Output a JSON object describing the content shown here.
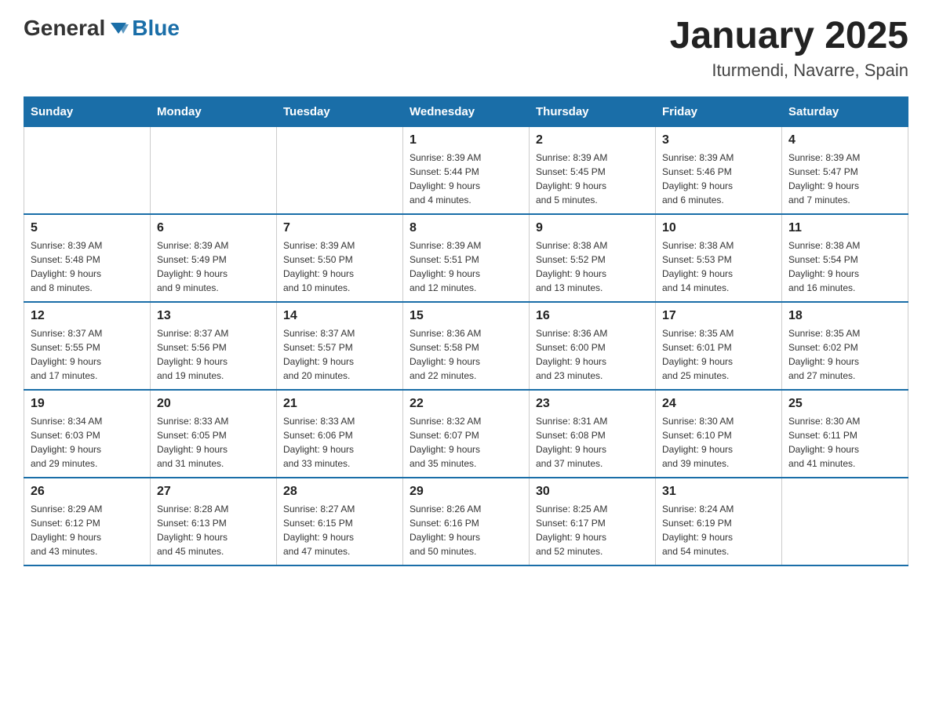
{
  "logo": {
    "text_general": "General",
    "text_blue": "Blue"
  },
  "title": {
    "month_year": "January 2025",
    "location": "Iturmendi, Navarre, Spain"
  },
  "weekdays": [
    "Sunday",
    "Monday",
    "Tuesday",
    "Wednesday",
    "Thursday",
    "Friday",
    "Saturday"
  ],
  "weeks": [
    [
      {
        "day": "",
        "info": ""
      },
      {
        "day": "",
        "info": ""
      },
      {
        "day": "",
        "info": ""
      },
      {
        "day": "1",
        "info": "Sunrise: 8:39 AM\nSunset: 5:44 PM\nDaylight: 9 hours\nand 4 minutes."
      },
      {
        "day": "2",
        "info": "Sunrise: 8:39 AM\nSunset: 5:45 PM\nDaylight: 9 hours\nand 5 minutes."
      },
      {
        "day": "3",
        "info": "Sunrise: 8:39 AM\nSunset: 5:46 PM\nDaylight: 9 hours\nand 6 minutes."
      },
      {
        "day": "4",
        "info": "Sunrise: 8:39 AM\nSunset: 5:47 PM\nDaylight: 9 hours\nand 7 minutes."
      }
    ],
    [
      {
        "day": "5",
        "info": "Sunrise: 8:39 AM\nSunset: 5:48 PM\nDaylight: 9 hours\nand 8 minutes."
      },
      {
        "day": "6",
        "info": "Sunrise: 8:39 AM\nSunset: 5:49 PM\nDaylight: 9 hours\nand 9 minutes."
      },
      {
        "day": "7",
        "info": "Sunrise: 8:39 AM\nSunset: 5:50 PM\nDaylight: 9 hours\nand 10 minutes."
      },
      {
        "day": "8",
        "info": "Sunrise: 8:39 AM\nSunset: 5:51 PM\nDaylight: 9 hours\nand 12 minutes."
      },
      {
        "day": "9",
        "info": "Sunrise: 8:38 AM\nSunset: 5:52 PM\nDaylight: 9 hours\nand 13 minutes."
      },
      {
        "day": "10",
        "info": "Sunrise: 8:38 AM\nSunset: 5:53 PM\nDaylight: 9 hours\nand 14 minutes."
      },
      {
        "day": "11",
        "info": "Sunrise: 8:38 AM\nSunset: 5:54 PM\nDaylight: 9 hours\nand 16 minutes."
      }
    ],
    [
      {
        "day": "12",
        "info": "Sunrise: 8:37 AM\nSunset: 5:55 PM\nDaylight: 9 hours\nand 17 minutes."
      },
      {
        "day": "13",
        "info": "Sunrise: 8:37 AM\nSunset: 5:56 PM\nDaylight: 9 hours\nand 19 minutes."
      },
      {
        "day": "14",
        "info": "Sunrise: 8:37 AM\nSunset: 5:57 PM\nDaylight: 9 hours\nand 20 minutes."
      },
      {
        "day": "15",
        "info": "Sunrise: 8:36 AM\nSunset: 5:58 PM\nDaylight: 9 hours\nand 22 minutes."
      },
      {
        "day": "16",
        "info": "Sunrise: 8:36 AM\nSunset: 6:00 PM\nDaylight: 9 hours\nand 23 minutes."
      },
      {
        "day": "17",
        "info": "Sunrise: 8:35 AM\nSunset: 6:01 PM\nDaylight: 9 hours\nand 25 minutes."
      },
      {
        "day": "18",
        "info": "Sunrise: 8:35 AM\nSunset: 6:02 PM\nDaylight: 9 hours\nand 27 minutes."
      }
    ],
    [
      {
        "day": "19",
        "info": "Sunrise: 8:34 AM\nSunset: 6:03 PM\nDaylight: 9 hours\nand 29 minutes."
      },
      {
        "day": "20",
        "info": "Sunrise: 8:33 AM\nSunset: 6:05 PM\nDaylight: 9 hours\nand 31 minutes."
      },
      {
        "day": "21",
        "info": "Sunrise: 8:33 AM\nSunset: 6:06 PM\nDaylight: 9 hours\nand 33 minutes."
      },
      {
        "day": "22",
        "info": "Sunrise: 8:32 AM\nSunset: 6:07 PM\nDaylight: 9 hours\nand 35 minutes."
      },
      {
        "day": "23",
        "info": "Sunrise: 8:31 AM\nSunset: 6:08 PM\nDaylight: 9 hours\nand 37 minutes."
      },
      {
        "day": "24",
        "info": "Sunrise: 8:30 AM\nSunset: 6:10 PM\nDaylight: 9 hours\nand 39 minutes."
      },
      {
        "day": "25",
        "info": "Sunrise: 8:30 AM\nSunset: 6:11 PM\nDaylight: 9 hours\nand 41 minutes."
      }
    ],
    [
      {
        "day": "26",
        "info": "Sunrise: 8:29 AM\nSunset: 6:12 PM\nDaylight: 9 hours\nand 43 minutes."
      },
      {
        "day": "27",
        "info": "Sunrise: 8:28 AM\nSunset: 6:13 PM\nDaylight: 9 hours\nand 45 minutes."
      },
      {
        "day": "28",
        "info": "Sunrise: 8:27 AM\nSunset: 6:15 PM\nDaylight: 9 hours\nand 47 minutes."
      },
      {
        "day": "29",
        "info": "Sunrise: 8:26 AM\nSunset: 6:16 PM\nDaylight: 9 hours\nand 50 minutes."
      },
      {
        "day": "30",
        "info": "Sunrise: 8:25 AM\nSunset: 6:17 PM\nDaylight: 9 hours\nand 52 minutes."
      },
      {
        "day": "31",
        "info": "Sunrise: 8:24 AM\nSunset: 6:19 PM\nDaylight: 9 hours\nand 54 minutes."
      },
      {
        "day": "",
        "info": ""
      }
    ]
  ]
}
